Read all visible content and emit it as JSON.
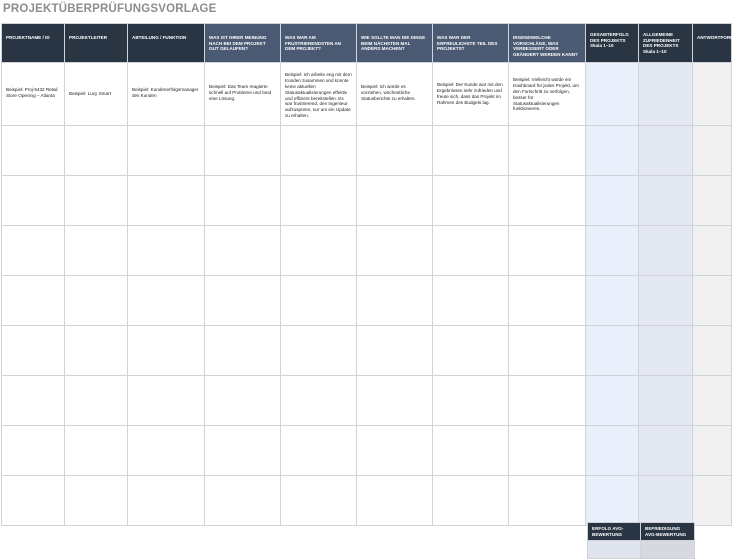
{
  "title": "PROJEKTÜBERPRÜFUNGSVORLAGE",
  "columns": [
    "PROJEKTNAME / ID",
    "PROJEKTLEITER",
    "ABTEILUNG / FUNKTION",
    "WAS IST IHRER MEINUNG NACH BEI DEM PROJEKT GUT GELAUFEN?",
    "WAS WAR AM FRUSTRIERENDSTEN AN DEM PROJEKT?",
    "WIE SOLLTE MAN DIE DINGE BEIM NÄCHSTEN MAL ANDERS MACHEN?",
    "WAS WAR DER ERFREULICHSTE TEIL DES PROJEKTS?",
    "IRGENDWELCHE VORSCHLÄGE, WAS VERBESSERT ODER GEÄNDERT WERDEN KANN?",
    "GESAMTERFOLG DES PROJEKTS Skala 1–10",
    "ALLGEMEINE ZUFRIEDENHEIT DES PROJEKTS Skala 1–10",
    "ANTWORTFORMULAR"
  ],
  "example_row": [
    "Beispiel: Proj-5432 Retail Store Opening – Atlanta",
    "Beispiel: Lucy Smart",
    "Beispiel: Kundenerfolgsmanager des Kunden",
    "Beispiel: Das Team reagierte schnell auf Probleme und fand eine Lösung.",
    "Beispiel: Ich arbeite eng mit dem Kunden zusammen und konnte keine aktuellen Statusaktualisierungen effektiv und effizient bereitstellen. Es war frustrierend, den Ingenieur aufzuspüren, nur um ein Update zu erhalten.",
    "Beispiel: Ich würde es vorziehen, wöchentliche Statusberichte zu erhalten.",
    "Beispiel: Der Kunde war mit den Ergebnissen sehr zufrieden und freute sich, dass das Projekt im Rahmen des Budgets lag.",
    "Beispiel: Vielleicht würde ein Dashboard für jedes Projekt, um den Fortschritt zu verfolgen, besser für Statusaktualisierungen funktionieren.",
    "",
    "",
    ""
  ],
  "footer": {
    "success_avg": "ERFOLG AVG-BEWERTUNG",
    "satisfaction_avg": "BEFRIEDIGUNG AVG-BEWERTUNG"
  }
}
